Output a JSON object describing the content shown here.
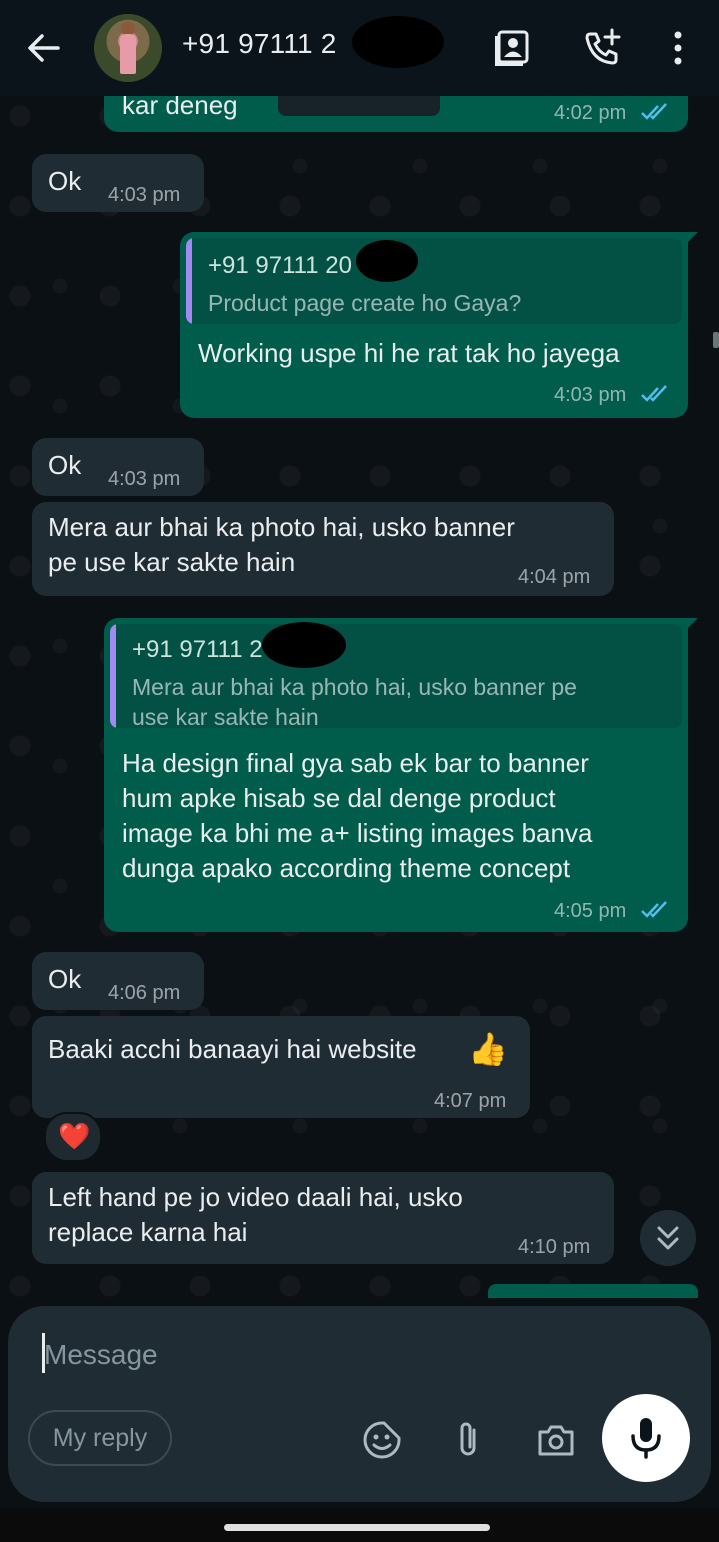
{
  "header": {
    "contact_name": "+91 97111 2",
    "icons": [
      "back-arrow-icon",
      "contact-card-icon",
      "call-add-icon",
      "more-vert-icon"
    ]
  },
  "messages": [
    {
      "id": "m0",
      "direction": "out",
      "text": "kar deneg",
      "time": "4:02 pm",
      "status": "read"
    },
    {
      "id": "m1",
      "direction": "in",
      "text": "Ok",
      "time": "4:03 pm"
    },
    {
      "id": "m2",
      "direction": "out",
      "quote_name": "+91 97111 20",
      "quote_text": "Product page create ho Gaya?",
      "text": "Working uspe hi he rat tak ho jayega",
      "time": "4:03 pm",
      "status": "read"
    },
    {
      "id": "m3",
      "direction": "in",
      "text": "Ok",
      "time": "4:03 pm"
    },
    {
      "id": "m4",
      "direction": "in",
      "text_lines": [
        "Mera aur bhai ka photo hai, usko banner",
        "pe use kar sakte hain"
      ],
      "time": "4:04 pm"
    },
    {
      "id": "m5",
      "direction": "out",
      "quote_name": "+91 97111 2",
      "quote_text_lines": [
        "Mera aur bhai ka photo hai, usko banner pe",
        "use kar sakte hain"
      ],
      "text_lines": [
        "Ha design final gya sab ek bar to banner",
        "hum apke hisab se dal denge product",
        "image ka bhi me a+ listing images banva",
        "dunga apako according theme concept"
      ],
      "time": "4:05 pm",
      "status": "read"
    },
    {
      "id": "m6",
      "direction": "in",
      "text": "Ok",
      "time": "4:06 pm"
    },
    {
      "id": "m7",
      "direction": "in",
      "text": "Baaki acchi banaayi hai website",
      "emoji": "👍",
      "time": "4:07 pm",
      "reaction": "❤️"
    },
    {
      "id": "m8",
      "direction": "in",
      "text_lines": [
        "Left hand pe jo video daali hai, usko",
        "replace karna hai"
      ],
      "time": "4:10 pm"
    }
  ],
  "composer": {
    "placeholder": "Message",
    "my_reply_label": "My reply",
    "icons": [
      "sticker-icon",
      "attach-icon",
      "camera-icon",
      "mic-icon"
    ]
  },
  "colors": {
    "incoming_bubble": "#202c33",
    "outgoing_bubble": "#005c4b",
    "read_tick": "#53bdeb",
    "quote_bar": "#a389f2"
  }
}
